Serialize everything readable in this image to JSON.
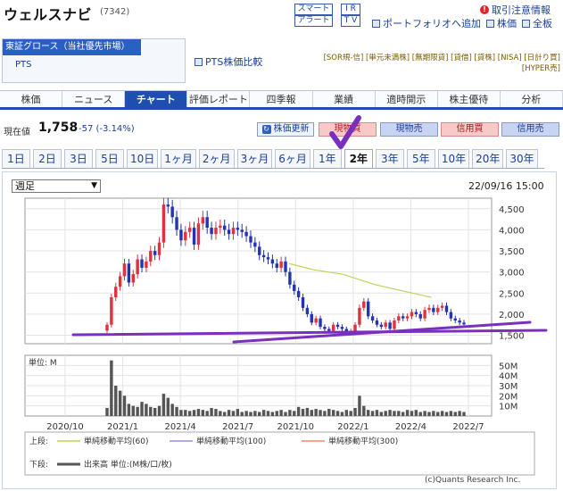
{
  "header": {
    "name": "ウェルスナビ",
    "code": "(7342)",
    "btn_smart": "スマート",
    "btn_alert": "アラート",
    "btn_ir": "I R",
    "btn_tv": "T V",
    "attention": "取引注意情報",
    "portfolio": "ポートフォリオへ追加",
    "board": "株価",
    "allboard": "全板"
  },
  "market": {
    "selected": "東証グロース（当社優先市場）",
    "pts": "PTS",
    "pts_compare": "PTS株価比較",
    "tags_line1": "[SOR規-信] [単元未満株] [無期限貸] [貸借] [貸株] [NISA] [日計り買]",
    "tags_line2": "[HYPER売]"
  },
  "tabs": [
    "株価",
    "ニュース",
    "チャート",
    "評価レポート",
    "四季報",
    "業績",
    "適時開示",
    "株主優待",
    "分析"
  ],
  "active_tab": 2,
  "price": {
    "label": "現在値",
    "value": "1,758",
    "change": "-57 (-3.14%)",
    "update": "株価更新",
    "spot_buy": "現物買",
    "spot_sell": "現物売",
    "margin_buy": "信用買",
    "margin_sell": "信用売"
  },
  "periods": [
    "1日",
    "2日",
    "3日",
    "5日",
    "10日",
    "1ヶ月",
    "2ヶ月",
    "3ヶ月",
    "6ヶ月",
    "1年",
    "2年",
    "3年",
    "5年",
    "10年",
    "20年",
    "30年"
  ],
  "active_period": 10,
  "chart": {
    "interval": "週足",
    "date": "22/09/16 15:00",
    "volume_unit": "単位: M",
    "copyright": "(c)Quants Research Inc.",
    "legend_upper_label": "上段:",
    "legend_lower_label": "下段:",
    "colors": {
      "up": "#e0313f",
      "down": "#2233b5",
      "ma60": "#b9d55a",
      "ma100": "#a58ad9",
      "ma300": "#ef8a6c",
      "volume": "#555555",
      "trend": "#7a2fbe"
    }
  },
  "chart_data": {
    "type": "candlestick",
    "x_ticks": [
      "2020/10",
      "2021/1",
      "2021/4",
      "2021/7",
      "2021/10",
      "2022/1",
      "2022/4",
      "2022/7"
    ],
    "price_ticks": [
      "4,500",
      "4,000",
      "3,500",
      "3,000",
      "2,500",
      "2,000",
      "1,500"
    ],
    "price_ylim": [
      1300,
      4750
    ],
    "volume_ticks": [
      "50M",
      "40M",
      "30M",
      "20M",
      "10M"
    ],
    "volume_ylim": [
      0,
      60
    ],
    "legend": [
      {
        "text": "単純移動平均(60)",
        "color": "#b9d55a"
      },
      {
        "text": "単純移動平均(100)",
        "color": "#a58ad9"
      },
      {
        "text": "単純移動平均(300)",
        "color": "#ef8a6c"
      },
      {
        "text": "出来高 単位:(M株/口/枚)",
        "color": "#555555"
      }
    ],
    "ma60": [
      [
        0.566,
        3200
      ],
      [
        0.62,
        3050
      ],
      [
        0.68,
        2950
      ],
      [
        0.75,
        2700
      ],
      [
        0.81,
        2550
      ],
      [
        0.871,
        2400
      ]
    ],
    "close": [
      1750,
      2400,
      2650,
      2900,
      3200,
      2750,
      2950,
      3300,
      3100,
      3250,
      3500,
      3400,
      3700,
      4600,
      4550,
      4300,
      4000,
      3750,
      3950,
      4050,
      3650,
      4150,
      4300,
      4050,
      3900,
      4050,
      4100,
      4000,
      3900,
      4050,
      4000,
      3950,
      3850,
      3700,
      3600,
      3400,
      3350,
      3300,
      3200,
      3100,
      3250,
      3000,
      2700,
      2550,
      2400,
      2150,
      2000,
      1800,
      1900,
      1700,
      1650,
      1600,
      1750,
      1700,
      1650,
      1550,
      1600,
      1750,
      2150,
      2300,
      1950,
      1850,
      1750,
      1700,
      1800,
      1650,
      1850,
      1950,
      1900,
      1950,
      2050,
      2000,
      1900,
      2100,
      2150,
      2050,
      2150,
      2200,
      2050,
      1900,
      1850,
      1800,
      1758
    ],
    "volume": [
      8,
      55,
      30,
      25,
      20,
      12,
      10,
      9,
      14,
      12,
      9,
      8,
      10,
      22,
      18,
      12,
      9,
      6,
      6,
      5,
      6,
      7,
      6,
      5,
      8,
      7,
      5,
      4,
      6,
      5,
      7,
      4,
      5,
      4,
      5,
      4,
      6,
      5,
      4,
      5,
      6,
      4,
      6,
      5,
      9,
      7,
      8,
      6,
      7,
      6,
      5,
      7,
      6,
      5,
      4,
      6,
      5,
      8,
      20,
      10,
      6,
      5,
      6,
      4,
      5,
      6,
      5,
      5,
      4,
      6,
      5,
      6,
      4,
      5,
      4,
      5,
      4,
      5,
      4,
      5,
      4,
      5,
      4
    ]
  }
}
